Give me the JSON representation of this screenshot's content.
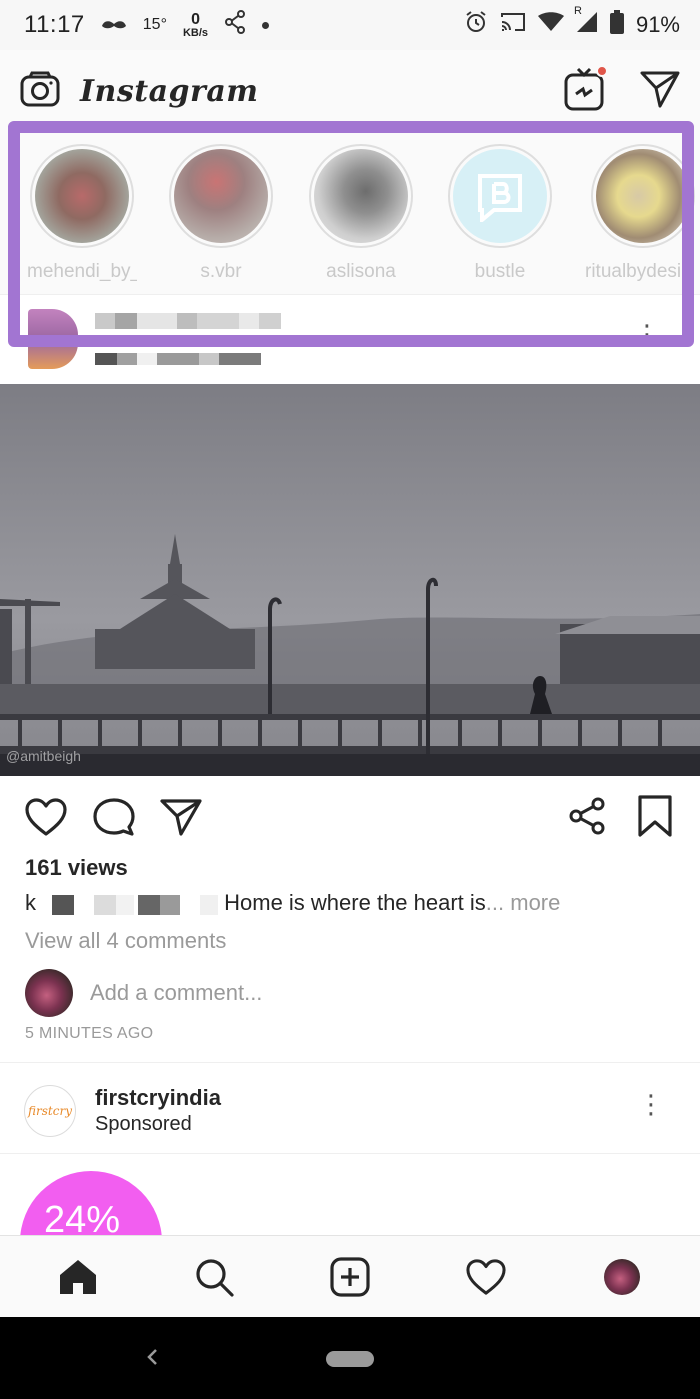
{
  "status_bar": {
    "time": "11:17",
    "temp": "15°",
    "net_speed_value": "0",
    "net_speed_unit": "KB/s",
    "battery": "91%",
    "signal_badge": "R"
  },
  "header": {
    "app_title": "Instagram"
  },
  "stories": [
    {
      "username": "mehendi_by_..."
    },
    {
      "username": "s.vbr"
    },
    {
      "username": "aslisona"
    },
    {
      "username": "bustle"
    },
    {
      "username": "ritualbydesi"
    }
  ],
  "post": {
    "photo_credit": "@amitbeigh",
    "views": "161 views",
    "caption_initial": "k",
    "caption_text": "Home is where the heart is",
    "caption_more": "... more",
    "view_comments": "View all 4 comments",
    "add_comment_placeholder": "Add a comment...",
    "time_ago": "5 MINUTES AGO"
  },
  "sponsored_post": {
    "account": "firstcryindia",
    "label": "Sponsored",
    "avatar_text": "firstcry",
    "ad_text": "24%"
  },
  "colors": {
    "highlight": "#a275d2",
    "notification_dot": "#e0564a",
    "ad_pink": "#f25ef0"
  }
}
